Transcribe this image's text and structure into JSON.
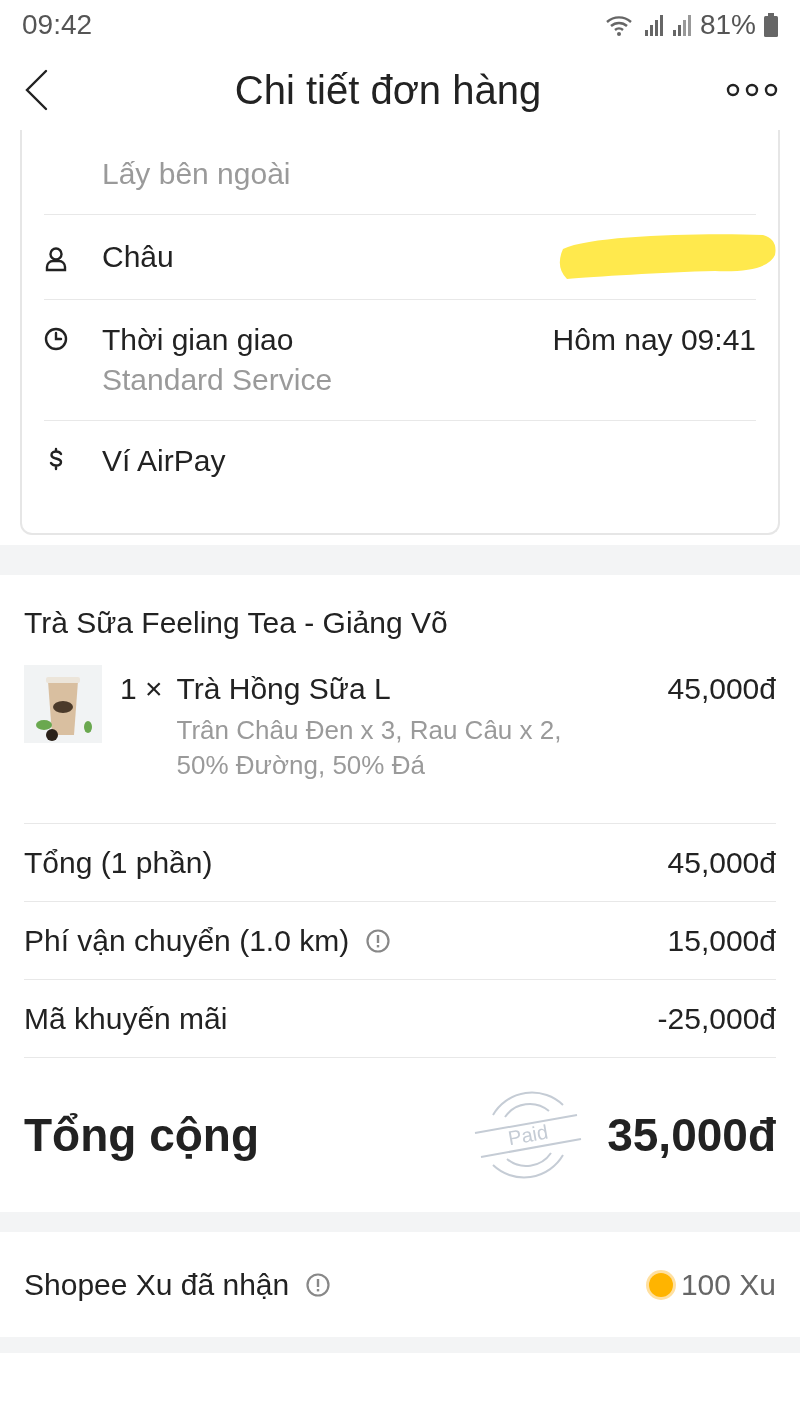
{
  "status_bar": {
    "time": "09:42",
    "battery": "81%"
  },
  "header": {
    "title": "Chi tiết đơn hàng"
  },
  "delivery_card": {
    "address_note": "Lấy bên ngoài",
    "rows": [
      {
        "kind": "person",
        "label": "Châu",
        "redacted": true
      },
      {
        "kind": "clock",
        "label": "Thời gian giao",
        "sub": "Standard Service",
        "value": "Hôm nay 09:41",
        "redacted": false
      },
      {
        "kind": "payment",
        "label": "Ví AirPay",
        "redacted": false
      }
    ]
  },
  "store": {
    "name": "Trà Sữa Feeling Tea - Giảng Võ",
    "items": [
      {
        "qty": "1 ×",
        "name": "Trà Hồng Sữa L",
        "options": "Trân Châu Đen x 3, Rau Câu x 2, 50% Đường, 50% Đá",
        "price": "45,000đ"
      }
    ]
  },
  "summary": {
    "rows": [
      {
        "label": "Tổng (1 phần)",
        "info": false,
        "value": "45,000đ"
      },
      {
        "label": "Phí vận chuyển (1.0 km)",
        "info": true,
        "value": "15,000đ"
      },
      {
        "label": "Mã khuyến mãi",
        "info": false,
        "value": "-25,000đ"
      }
    ],
    "total": {
      "label": "Tổng cộng",
      "value": "35,000đ",
      "stamp": "Paid"
    }
  },
  "coins": {
    "label": "Shopee Xu đã nhận",
    "info": true,
    "value": "100 Xu"
  }
}
